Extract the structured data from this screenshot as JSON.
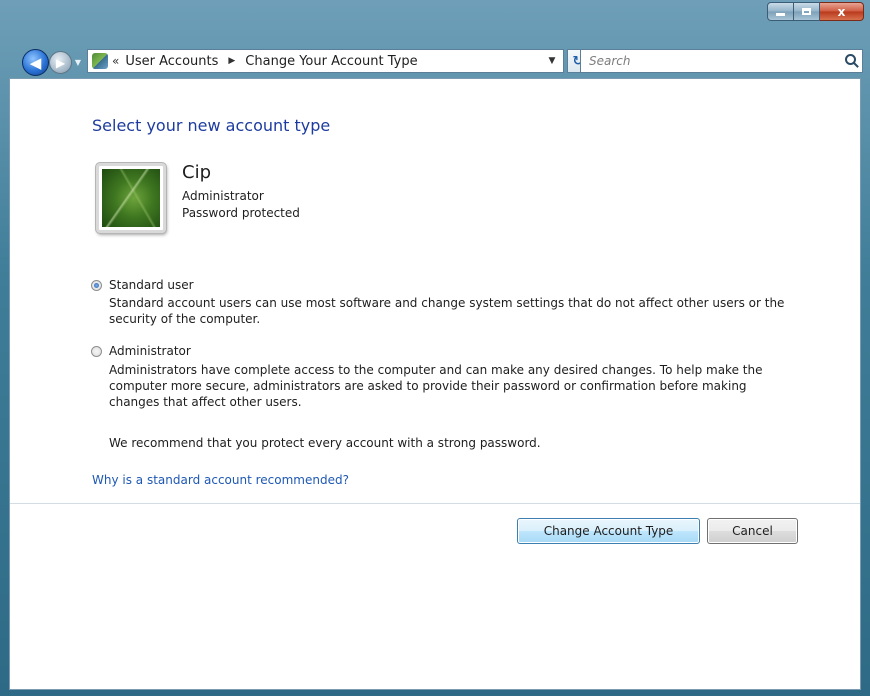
{
  "window": {
    "caption": {
      "close_glyph": "x"
    }
  },
  "navbar": {
    "back_glyph": "◀",
    "forward_glyph": "▶",
    "history_glyph": "▼",
    "address": {
      "chevron": "«",
      "breadcrumbs": [
        "User Accounts",
        "Change Your Account Type"
      ],
      "separator": "▶",
      "dropdown_glyph": "▼"
    },
    "refresh_glyph": "↻",
    "search": {
      "placeholder": "Search",
      "value": ""
    }
  },
  "main": {
    "title": "Select your new account type",
    "user": {
      "name": "Cip",
      "role": "Administrator",
      "status": "Password protected"
    },
    "options": [
      {
        "label": "Standard user",
        "selected": true,
        "description": "Standard account users can use most software and change system settings that do not affect other users or the security of the computer."
      },
      {
        "label": "Administrator",
        "selected": false,
        "description": "Administrators have complete access to the computer and can make any desired changes. To help make the computer more secure, administrators are asked to provide their password or confirmation before making changes that affect other users."
      }
    ],
    "recommendation": "We recommend that you protect every account with a strong password.",
    "help_link": "Why is a standard account recommended?"
  },
  "actions": {
    "primary_label": "Change Account Type",
    "cancel_label": "Cancel"
  }
}
